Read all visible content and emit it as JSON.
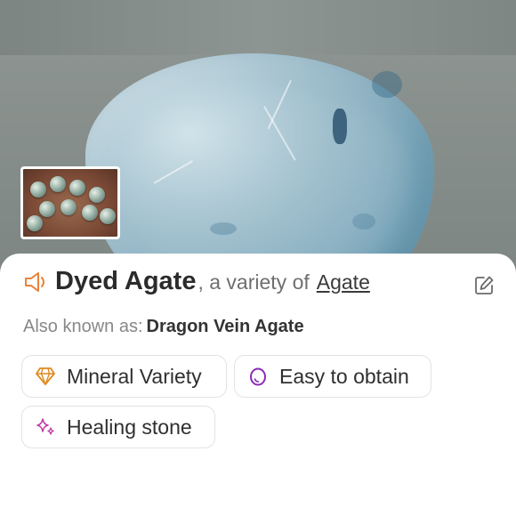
{
  "detail": {
    "name": "Dyed Agate",
    "variety_text": ", a variety of",
    "parent": "Agate",
    "aka_label": "Also known as:",
    "aka_value": "Dragon Vein Agate"
  },
  "tags": [
    {
      "label": "Mineral Variety",
      "icon": "gem-icon",
      "color": "#e08a1e"
    },
    {
      "label": "Easy to obtain",
      "icon": "egg-icon",
      "color": "#8a2bb8"
    },
    {
      "label": "Healing stone",
      "icon": "sparkles-icon",
      "color": "#c23aa6"
    }
  ],
  "colors": {
    "accent": "#e8823a",
    "title": "#2b2b2b"
  }
}
